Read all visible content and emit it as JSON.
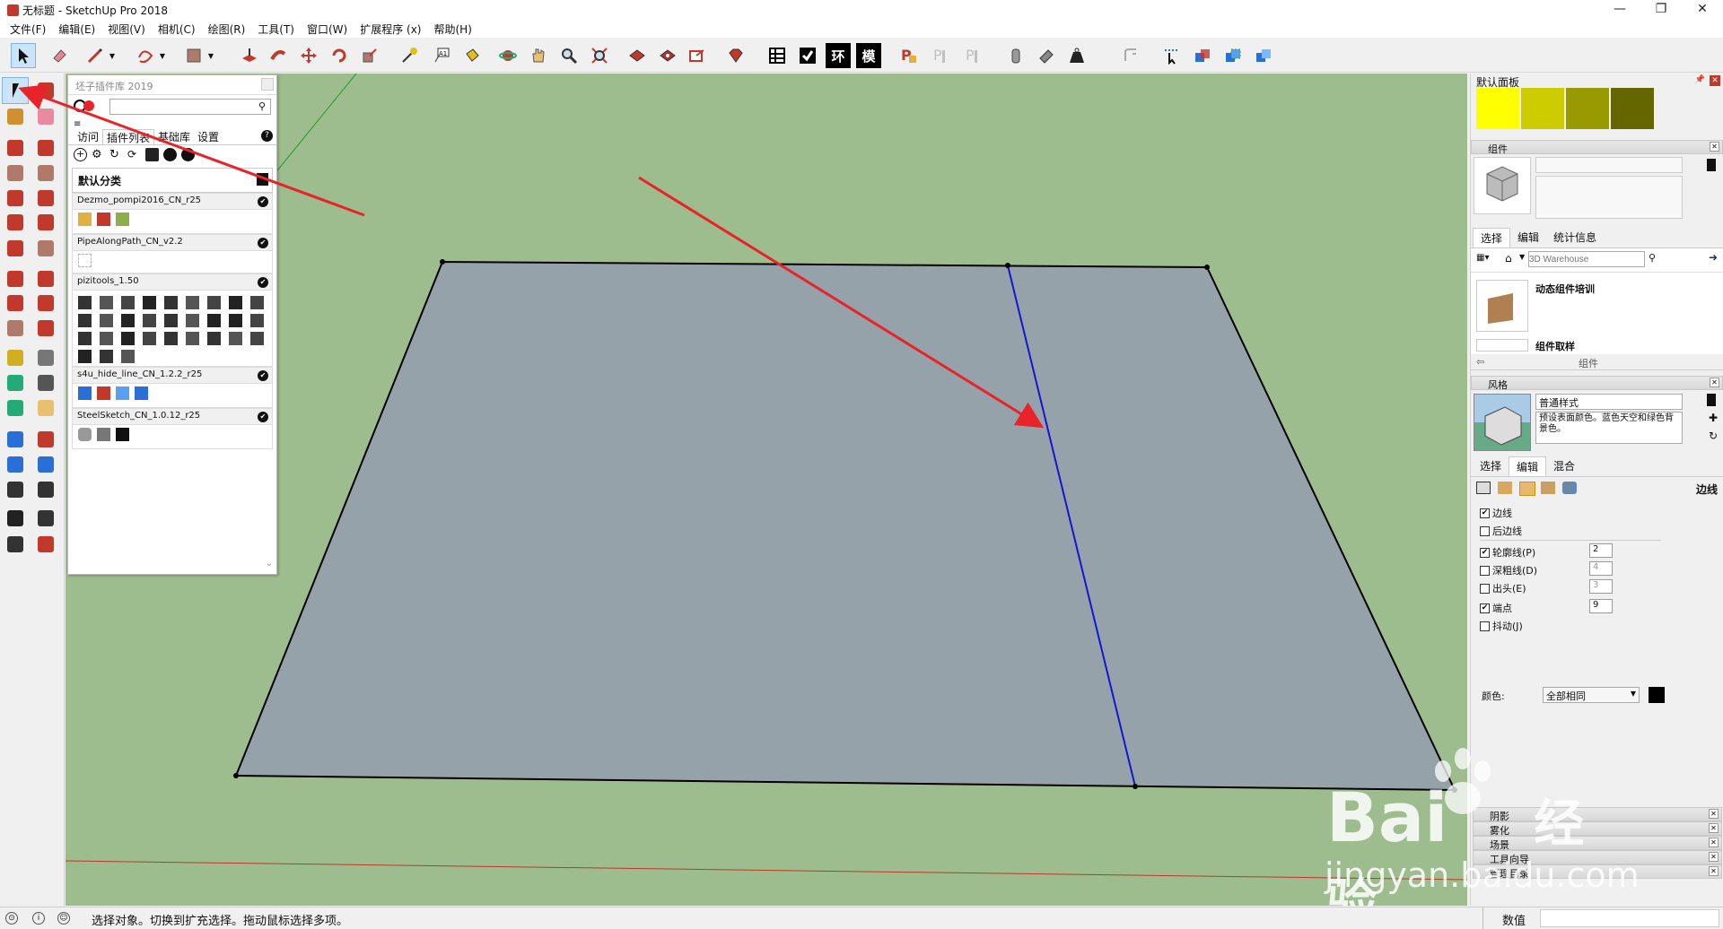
{
  "window": {
    "title": "无标题 - SketchUp Pro 2018",
    "min": "—",
    "max": "❐",
    "close": "✕"
  },
  "menu": [
    "文件(F)",
    "编辑(E)",
    "视图(V)",
    "相机(C)",
    "绘图(R)",
    "工具(T)",
    "窗口(W)",
    "扩展程序 (x)",
    "帮助(H)"
  ],
  "toolbar_text_buttons": [
    "环",
    "模"
  ],
  "plugin_panel": {
    "title": "坯子插件库 2019",
    "search_placeholder": "",
    "tabs": [
      "访问",
      "插件列表",
      "基础库",
      "设置"
    ],
    "help": "?",
    "category_header": "默认分类",
    "categories": [
      {
        "name": "Dezmo_pompi2016_CN_r25"
      },
      {
        "name": "PipeAlongPath_CN_v2.2"
      },
      {
        "name": "pizitools_1.50"
      },
      {
        "name": "s4u_hide_line_CN_1.2.2_r25"
      },
      {
        "name": "SteelSketch_CN_1.0.12_r25"
      }
    ]
  },
  "right_panel": {
    "default_tray": "默认面板",
    "swatch_colors": [
      "#ffff00",
      "#cccc00",
      "#999900",
      "#666600"
    ],
    "components": {
      "header": "组件",
      "tabs": [
        "选择",
        "编辑",
        "统计信息"
      ],
      "search_placeholder": "3D Warehouse",
      "items": [
        "动态组件培训",
        "组件取样"
      ],
      "footer": "组件"
    },
    "styles": {
      "header": "风格",
      "name": "普通样式",
      "description": "预设表面颜色。蓝色天空和绿色背景色。",
      "tabs": [
        "选择",
        "编辑",
        "混合"
      ],
      "edge_label": "边线",
      "options": [
        {
          "label": "边线",
          "checked": true
        },
        {
          "label": "后边线",
          "checked": false
        },
        {
          "label": "轮廓线(P)",
          "checked": true,
          "value": "2"
        },
        {
          "label": "深粗线(D)",
          "checked": false,
          "value": "4"
        },
        {
          "label": "出头(E)",
          "checked": false,
          "value": "3"
        },
        {
          "label": "端点",
          "checked": true,
          "value": "9"
        },
        {
          "label": "抖动(J)",
          "checked": false
        }
      ],
      "color_label": "颜色:",
      "color_value": "全部相同"
    },
    "collapsed_trays": [
      "阴影",
      "雾化",
      "场景",
      "工具向导",
      "管理目录"
    ]
  },
  "status": {
    "message": "选择对象。切换到扩充选择。拖动鼠标选择多项。",
    "measure_label": "数值"
  },
  "watermark": {
    "brand": "Bai",
    "cn": "经验",
    "url": "jingyan.baidu.com"
  },
  "colors": {
    "viewport_bg": "#9dbd8e",
    "face": "#95a2aa",
    "annotation_arrow": "#e8232a",
    "selected_edge": "#1515d0"
  }
}
